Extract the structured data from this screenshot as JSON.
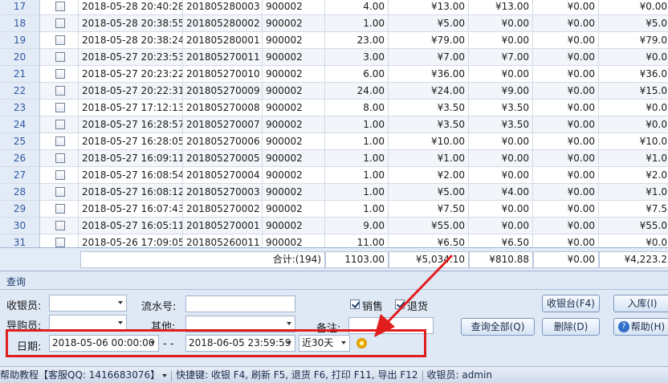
{
  "rows": [
    {
      "idx": "17",
      "time": "2018-05-28 20:40:28",
      "no": "201805280003",
      "code": "900002",
      "qty": "4.00",
      "a1": "¥13.00",
      "a2": "¥13.00",
      "a3": "¥0.00",
      "a4": "¥0.00"
    },
    {
      "idx": "18",
      "time": "2018-05-28 20:38:55",
      "no": "201805280002",
      "code": "900002",
      "qty": "1.00",
      "a1": "¥5.00",
      "a2": "¥0.00",
      "a3": "¥0.00",
      "a4": "¥5.0"
    },
    {
      "idx": "19",
      "time": "2018-05-28 20:38:24",
      "no": "201805280001",
      "code": "900002",
      "qty": "23.00",
      "a1": "¥79.00",
      "a2": "¥0.00",
      "a3": "¥0.00",
      "a4": "¥79.0"
    },
    {
      "idx": "20",
      "time": "2018-05-27 20:23:53",
      "no": "201805270011",
      "code": "900002",
      "qty": "3.00",
      "a1": "¥7.00",
      "a2": "¥7.00",
      "a3": "¥0.00",
      "a4": "¥0.0"
    },
    {
      "idx": "21",
      "time": "2018-05-27 20:23:22",
      "no": "201805270010",
      "code": "900002",
      "qty": "6.00",
      "a1": "¥36.00",
      "a2": "¥0.00",
      "a3": "¥0.00",
      "a4": "¥36.0"
    },
    {
      "idx": "22",
      "time": "2018-05-27 20:22:31",
      "no": "201805270009",
      "code": "900002",
      "qty": "24.00",
      "a1": "¥24.00",
      "a2": "¥9.00",
      "a3": "¥0.00",
      "a4": "¥15.0"
    },
    {
      "idx": "23",
      "time": "2018-05-27 17:12:13",
      "no": "201805270008",
      "code": "900002",
      "qty": "8.00",
      "a1": "¥3.50",
      "a2": "¥3.50",
      "a3": "¥0.00",
      "a4": "¥0.0"
    },
    {
      "idx": "24",
      "time": "2018-05-27 16:28:57",
      "no": "201805270007",
      "code": "900002",
      "qty": "1.00",
      "a1": "¥3.50",
      "a2": "¥3.50",
      "a3": "¥0.00",
      "a4": "¥0.0"
    },
    {
      "idx": "25",
      "time": "2018-05-27 16:28:05",
      "no": "201805270006",
      "code": "900002",
      "qty": "1.00",
      "a1": "¥10.00",
      "a2": "¥0.00",
      "a3": "¥0.00",
      "a4": "¥10.0"
    },
    {
      "idx": "26",
      "time": "2018-05-27 16:09:11",
      "no": "201805270005",
      "code": "900002",
      "qty": "1.00",
      "a1": "¥1.00",
      "a2": "¥0.00",
      "a3": "¥0.00",
      "a4": "¥1.0"
    },
    {
      "idx": "27",
      "time": "2018-05-27 16:08:54",
      "no": "201805270004",
      "code": "900002",
      "qty": "1.00",
      "a1": "¥2.00",
      "a2": "¥0.00",
      "a3": "¥0.00",
      "a4": "¥2.0"
    },
    {
      "idx": "28",
      "time": "2018-05-27 16:08:12",
      "no": "201805270003",
      "code": "900002",
      "qty": "1.00",
      "a1": "¥5.00",
      "a2": "¥4.00",
      "a3": "¥0.00",
      "a4": "¥1.0"
    },
    {
      "idx": "29",
      "time": "2018-05-27 16:07:43",
      "no": "201805270002",
      "code": "900002",
      "qty": "1.00",
      "a1": "¥7.50",
      "a2": "¥0.00",
      "a3": "¥0.00",
      "a4": "¥7.5"
    },
    {
      "idx": "30",
      "time": "2018-05-27 16:05:11",
      "no": "201805270001",
      "code": "900002",
      "qty": "9.00",
      "a1": "¥55.00",
      "a2": "¥0.00",
      "a3": "¥0.00",
      "a4": "¥55.0"
    },
    {
      "idx": "31",
      "time": "2018-05-26 17:09:05",
      "no": "201805260011",
      "code": "900002",
      "qty": "11.00",
      "a1": "¥6.50",
      "a2": "¥6.50",
      "a3": "¥0.00",
      "a4": "¥0.0"
    }
  ],
  "summary": {
    "label": "合计:(194)",
    "qty": "1103.00",
    "a1": "¥5,034.10",
    "a2": "¥810.88",
    "a3": "¥0.00",
    "a4": "¥4,223.2"
  },
  "query": {
    "title": "查询",
    "cashier_label": "收银员:",
    "buyer_label": "导购员:",
    "serial_label": "流水号:",
    "other_label": "其他:",
    "remark_label": "备注:",
    "sale_label": "销售",
    "return_label": "退货",
    "date_label": "日期:",
    "date_from": "2018-05-06 00:00:00",
    "date_sep": "- -",
    "date_to": "2018-06-05 23:59:59",
    "range": "近30天",
    "buttons": {
      "register": "收银台(F4)",
      "stock_in": "入库(I)",
      "query_all": "查询全部(Q)",
      "delete": "删除(D)",
      "help": "帮助(H)"
    }
  },
  "status": {
    "tutorial": "帮助教程【客服QQ: 1416683076】",
    "shortcuts": "快捷键: 收银 F4, 刷新 F5, 退货 F6, 打印 F11, 导出 F12",
    "cashier": "收银员: admin"
  },
  "colors": {
    "highlight": "#e01e1e",
    "panel": "#dfe8f5",
    "accent": "#2c58a4"
  }
}
